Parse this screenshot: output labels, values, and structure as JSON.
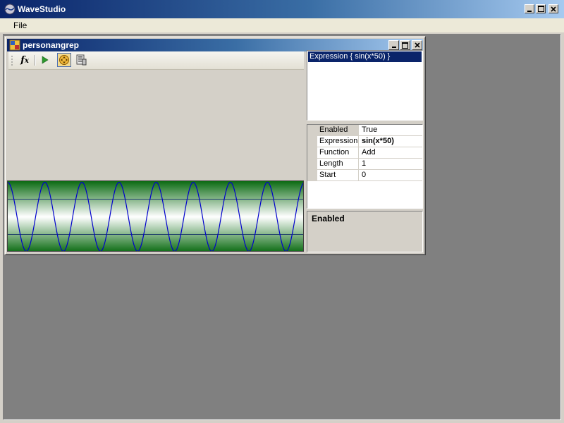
{
  "app": {
    "title": "WaveStudio",
    "icon": "wavestudio-app-icon"
  },
  "menu": {
    "file_label": "File"
  },
  "child_window": {
    "title": "personangrep",
    "icon": "document-window-icon"
  },
  "toolbar": {
    "function_button_icon": "fx-icon",
    "run_button_icon": "play-icon",
    "move_tool_icon": "move-icon",
    "properties_button_icon": "property-list-icon",
    "move_tool_active": true
  },
  "expressions": {
    "items": [
      "Expression { sin(x*50) }"
    ],
    "selected_index": 0
  },
  "properties": [
    {
      "name": "Enabled",
      "value": "True",
      "selected": true,
      "bold": false
    },
    {
      "name": "Expression",
      "value": "sin(x*50)",
      "selected": false,
      "bold": true
    },
    {
      "name": "Function",
      "value": "Add",
      "selected": false,
      "bold": false
    },
    {
      "name": "Length",
      "value": "1",
      "selected": false,
      "bold": false
    },
    {
      "name": "Start",
      "value": "0",
      "selected": false,
      "bold": false
    }
  ],
  "description": {
    "title": "Enabled"
  },
  "waveform": {
    "cycles": 8,
    "line_color": "#0000cc",
    "background_edge_color": "#0b6b12",
    "background_center_color": "#ffffff"
  },
  "colors": {
    "titlebar_start": "#0a246a",
    "titlebar_end": "#a6caf0",
    "workspace": "#808080",
    "selection": "#0a246a"
  }
}
